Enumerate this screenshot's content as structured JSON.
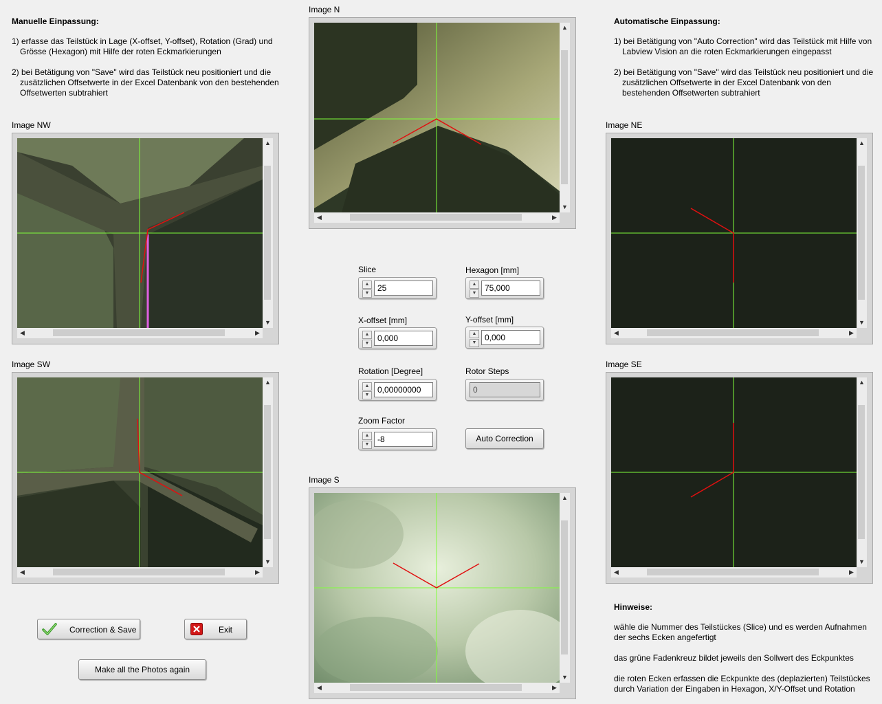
{
  "left_panel": {
    "heading": "Manuelle Einpassung:",
    "step1": "1) erfasse das Teilstück in Lage (X-offset, Y-offset), Rotation (Grad) und Grösse (Hexagon) mit Hilfe der roten Eckmarkierungen",
    "step2": "2) bei Betätigung von \"Save\" wird das Teilstück neu positioniert und die zusätzlichen Offsetwerte in der Excel Datenbank von den bestehenden Offsetwerten subtrahiert"
  },
  "right_panel": {
    "heading": "Automatische Einpassung:",
    "step1": "1) bei Betätigung von \"Auto Correction\" wird das Teilstück mit Hilfe von Labview Vision an die roten Eckmarkierungen eingepasst",
    "step2": "2) bei Betätigung von \"Save\" wird das Teilstück neu positioniert und die zusätzlichen Offsetwerte in der Excel Datenbank von den bestehenden Offsetwerten subtrahiert"
  },
  "images": {
    "n": "Image N",
    "nw": "Image NW",
    "ne": "Image NE",
    "sw": "Image SW",
    "se": "Image SE",
    "s": "Image S"
  },
  "controls": {
    "slice": {
      "label": "Slice",
      "value": "25"
    },
    "hexagon": {
      "label": "Hexagon [mm]",
      "value": "75,000"
    },
    "x_offset": {
      "label": "X-offset [mm]",
      "value": "0,000"
    },
    "y_offset": {
      "label": "Y-offset [mm]",
      "value": "0,000"
    },
    "rotation": {
      "label": "Rotation [Degree]",
      "value": "0,00000000"
    },
    "rotor_steps": {
      "label": "Rotor Steps",
      "value": "0"
    },
    "zoom": {
      "label": "Zoom Factor",
      "value": "-8"
    },
    "auto_correction": "Auto Correction"
  },
  "buttons": {
    "correction_save": "Correction & Save",
    "exit": "Exit",
    "photos_again": "Make all the Photos again"
  },
  "hints": {
    "heading": "Hinweise:",
    "h1": "wähle die Nummer des  Teilstückes (Slice) und es werden Aufnahmen der sechs Ecken angefertigt",
    "h2": "das grüne Fadenkreuz bildet jeweils den Sollwert des Eckpunktes",
    "h3": "die roten Ecken erfassen die Eckpunkte des (deplazierten) Teilstückes durch Variation der Eingaben in Hexagon, X/Y-Offset und Rotation"
  },
  "colors": {
    "crosshair": "#7fff3a",
    "marker": "#e01010",
    "panel": "#f0f0f0"
  }
}
